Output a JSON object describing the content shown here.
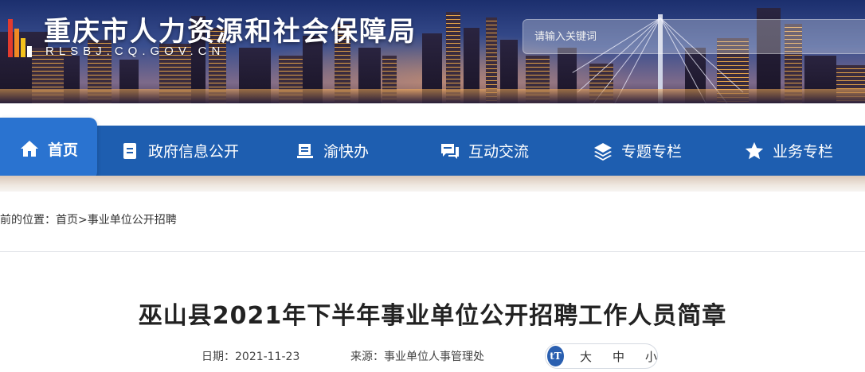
{
  "header": {
    "site_title": "重庆市人力资源和社会保障局",
    "site_domain": "RLSBJ.CQ.GOV.CN",
    "search_placeholder": "请输入关键词"
  },
  "nav": {
    "items": [
      {
        "label": "首页",
        "icon": "home-icon",
        "active": true
      },
      {
        "label": "政府信息公开",
        "icon": "document-icon"
      },
      {
        "label": "渝快办",
        "icon": "book-icon"
      },
      {
        "label": "互动交流",
        "icon": "chat-icon"
      },
      {
        "label": "专题专栏",
        "icon": "layers-icon"
      },
      {
        "label": "业务专栏",
        "icon": "star-icon"
      }
    ]
  },
  "breadcrumb": {
    "prefix": "前的位置：",
    "home": "首页",
    "separator": ">",
    "current": "事业单位公开招聘"
  },
  "article": {
    "title": "巫山县2021年下半年事业单位公开招聘工作人员简章",
    "date_label": "日期：",
    "date": "2021-11-23",
    "source_label": "来源：",
    "source": "事业单位人事管理处"
  },
  "font_size": {
    "icon": "tT",
    "large": "大",
    "medium": "中",
    "small": "小"
  },
  "colors": {
    "nav_bg": "#1e5eb0",
    "nav_active": "#2a73d0",
    "title_text": "#222222"
  }
}
